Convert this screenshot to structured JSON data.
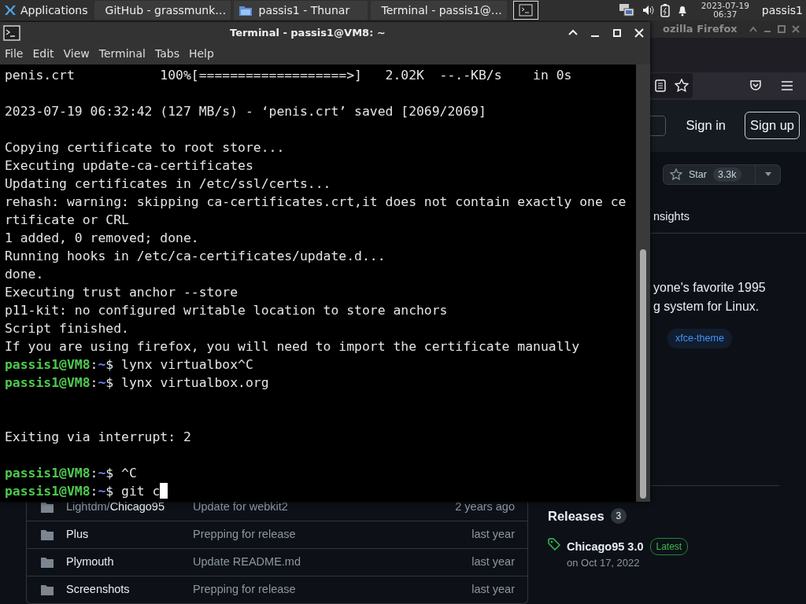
{
  "taskbar": {
    "menu_label": "Applications",
    "tasks": [
      {
        "kind": "browser",
        "title": "GitHub - grassmunk…"
      },
      {
        "kind": "folder",
        "title": "passis1 - Thunar"
      },
      {
        "kind": "terminal",
        "title": "Terminal - passis1@…"
      }
    ],
    "clock": {
      "date": "2023-07-19",
      "time": "06:37"
    },
    "user": "passis1"
  },
  "browser": {
    "title": "ozilla Firefox",
    "auth": [
      "Sign in",
      "Sign up"
    ],
    "star": {
      "label": "Star",
      "count": "3.3k"
    },
    "tab": "nsights",
    "about": [
      "yone's favorite 1995",
      "g system for Linux."
    ],
    "topics": [
      "xfce-theme"
    ],
    "files": [
      {
        "path": "Lightdm/",
        "name": "Chicago95",
        "message": "Update for webkit2",
        "age": "2 years ago"
      },
      {
        "name": "Plus",
        "message": "Prepping for release",
        "age": "last year"
      },
      {
        "name": "Plymouth",
        "message": "Update README.md",
        "age": "last year"
      },
      {
        "name": "Screenshots",
        "message": "Prepping for release",
        "age": "last year"
      }
    ],
    "releases": {
      "title": "Releases",
      "count": "3",
      "latest": {
        "name": "Chicago95 3.0",
        "badge": "Latest",
        "date": "on Oct 17, 2022"
      }
    }
  },
  "terminal": {
    "title": "Terminal - passis1@VM8: ~",
    "menu": [
      "File",
      "Edit",
      "View",
      "Terminal",
      "Tabs",
      "Help"
    ],
    "lines": [
      {
        "kind": "output",
        "text": "penis.crt           100%[===================>]   2.02K  --.-KB/s    in 0s"
      },
      {
        "kind": "blank"
      },
      {
        "kind": "output",
        "text": "2023-07-19 06:32:42 (127 MB/s) - ‘penis.crt’ saved [2069/2069]"
      },
      {
        "kind": "blank"
      },
      {
        "kind": "output",
        "text": "Copying certificate to root store..."
      },
      {
        "kind": "output",
        "text": "Executing update-ca-certificates"
      },
      {
        "kind": "output",
        "text": "Updating certificates in /etc/ssl/certs..."
      },
      {
        "kind": "output",
        "text": "rehash: warning: skipping ca-certificates.crt,it does not contain exactly one ce"
      },
      {
        "kind": "output",
        "text": "rtificate or CRL"
      },
      {
        "kind": "output",
        "text": "1 added, 0 removed; done."
      },
      {
        "kind": "output",
        "text": "Running hooks in /etc/ca-certificates/update.d..."
      },
      {
        "kind": "output",
        "text": "done."
      },
      {
        "kind": "output",
        "text": "Executing trust anchor --store"
      },
      {
        "kind": "output",
        "text": "p11-kit: no configured writable location to store anchors"
      },
      {
        "kind": "output",
        "text": "Script finished."
      },
      {
        "kind": "output",
        "text": "If you are using firefox, you will need to import the certificate manually"
      },
      {
        "kind": "prompt",
        "user": "passis1@VM8",
        "sep": ":",
        "path": "~",
        "symbol": "$",
        "command": "lynx virtualbox^C",
        "cursor": false
      },
      {
        "kind": "prompt",
        "user": "passis1@VM8",
        "sep": ":",
        "path": "~",
        "symbol": "$",
        "command": "lynx virtualbox.org",
        "cursor": false
      },
      {
        "kind": "blank"
      },
      {
        "kind": "blank"
      },
      {
        "kind": "output",
        "text": "Exiting via interrupt: 2"
      },
      {
        "kind": "blank"
      },
      {
        "kind": "prompt",
        "user": "passis1@VM8",
        "sep": ":",
        "path": "~",
        "symbol": "$",
        "command": "^C",
        "cursor": false
      },
      {
        "kind": "prompt",
        "user": "passis1@VM8",
        "sep": ":",
        "path": "~",
        "symbol": "$",
        "command": "git c",
        "cursor": true
      }
    ]
  }
}
